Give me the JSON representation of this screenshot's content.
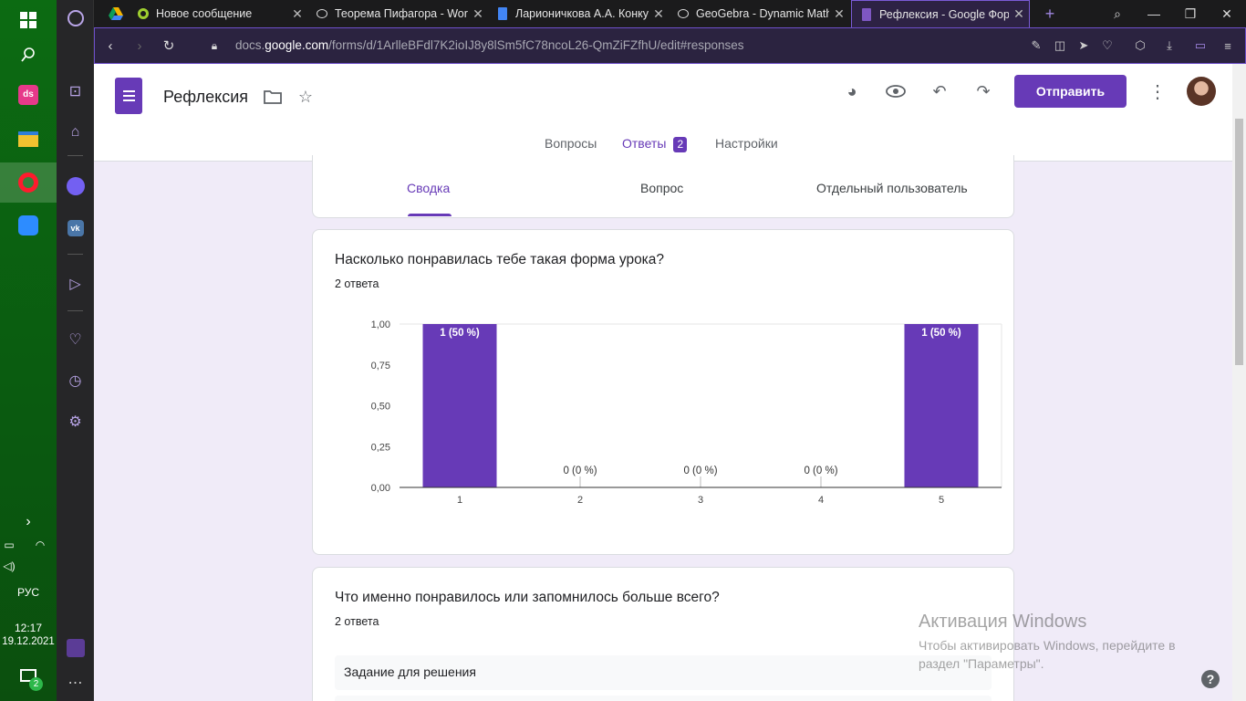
{
  "taskbar": {
    "language": "РУС",
    "time": "12:17",
    "date": "19.12.2021",
    "notifications": "2"
  },
  "browser": {
    "tabs": [
      {
        "title": "Новое сообщение",
        "icon": "speedbolt-icon"
      },
      {
        "title": "Теорема Пифагора - Work",
        "icon": "geogebra-icon"
      },
      {
        "title": "Ларионичкова А.А. Конку",
        "icon": "docs-icon"
      },
      {
        "title": "GeoGebra - Dynamic Mathe",
        "icon": "geogebra-icon"
      },
      {
        "title": "Рефлексия - Google Форм",
        "icon": "forms-icon"
      }
    ],
    "url_prefix": "docs.",
    "url_domain": "google.com",
    "url_rest": "/forms/d/1ArlleBFdl7K2ioIJ8y8lSm5fC78ncoL26-QmZiFZfhU/edit#responses"
  },
  "form": {
    "title": "Рефлексия",
    "send_label": "Отправить",
    "tabs": {
      "questions": "Вопросы",
      "responses": "Ответы",
      "responses_count": "2",
      "settings": "Настройки"
    },
    "subtabs": {
      "summary": "Сводка",
      "question": "Вопрос",
      "individual": "Отдельный пользователь"
    }
  },
  "question1": {
    "title": "Насколько понравилась тебе такая форма урока?",
    "count": "2 ответа"
  },
  "question2": {
    "title": "Что именно понравилось или запомнилось больше всего?",
    "count": "2 ответа",
    "answers": [
      "Задание для решения"
    ]
  },
  "chart_data": {
    "type": "bar",
    "categories": [
      "1",
      "2",
      "3",
      "4",
      "5"
    ],
    "values": [
      1,
      0,
      0,
      0,
      1
    ],
    "data_labels": [
      "1 (50 %)",
      "0 (0 %)",
      "0 (0 %)",
      "0 (0 %)",
      "1 (50 %)"
    ],
    "y_ticks": [
      "0,00",
      "0,25",
      "0,50",
      "0,75",
      "1,00"
    ],
    "ylim": [
      0,
      1
    ],
    "color": "#673ab7"
  },
  "watermark": {
    "line1": "Активация Windows",
    "line2": "Чтобы активировать Windows, перейдите в раздел \"Параметры\"."
  },
  "colors": {
    "accent": "#673ab7",
    "taskbar": "#0c6b12"
  }
}
